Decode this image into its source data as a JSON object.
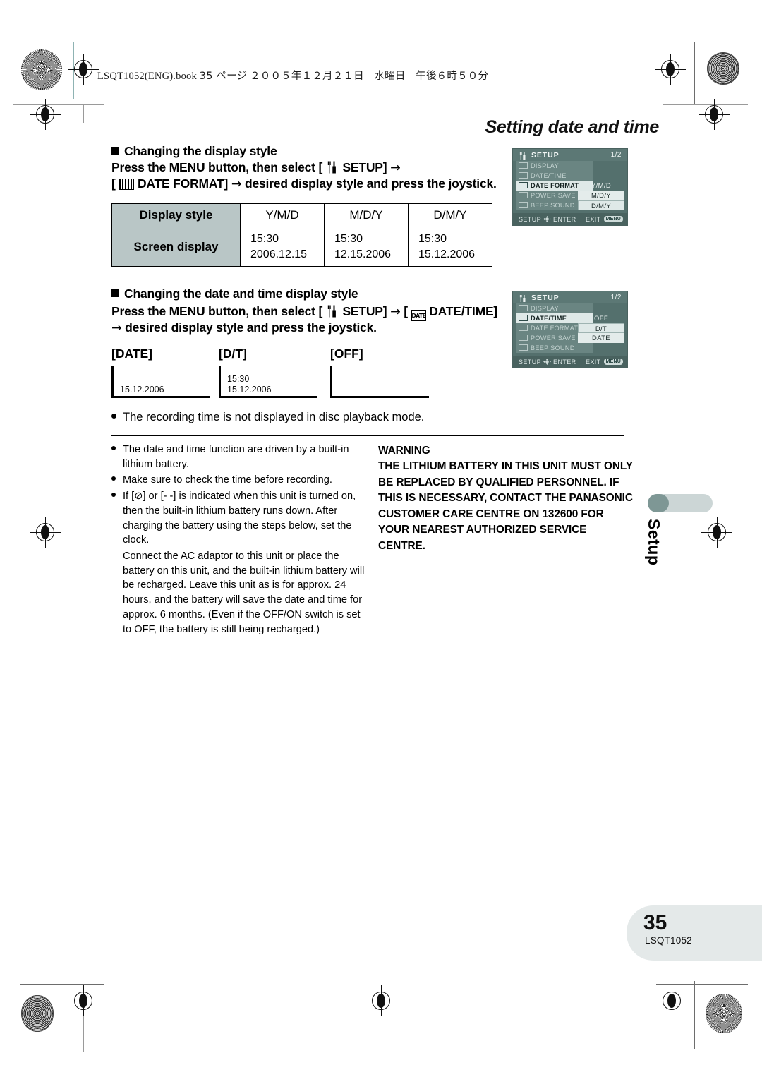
{
  "print": {
    "slug_code": "LSQT1052(ENG).book",
    "slug_page": "35 ページ",
    "slug_date": "２００５年１２月２１日　水曜日　午後６時５０分"
  },
  "running_title": "Setting date and time",
  "section1": {
    "heading": "Changing the display style",
    "line1_a": "Press the MENU button, then select [",
    "line1_setup": "SETUP]",
    "line1_arrow": "→",
    "line2_a": "[",
    "line2_b": "DATE FORMAT]",
    "line2_arrow": "→",
    "line2_c": "desired display style and press the joystick."
  },
  "table": {
    "row_label_1": "Display style",
    "row_label_2": "Screen display",
    "columns": [
      "Y/M/D",
      "M/D/Y",
      "D/M/Y"
    ],
    "values": [
      {
        "time": "15:30",
        "date": "2006.12.15"
      },
      {
        "time": "15:30",
        "date": "12.15.2006"
      },
      {
        "time": "15:30",
        "date": "15.12.2006"
      }
    ]
  },
  "section2": {
    "heading": "Changing the date and time display style",
    "line1_a": "Press the MENU button, then select [",
    "line1_setup": "SETUP]",
    "line1_arrow1": "→",
    "line1_b": "[",
    "line1_c": "DATE/TIME]",
    "line2_arrow": "→",
    "line2": "desired display style and press the joystick."
  },
  "samples": [
    {
      "label": "[DATE]",
      "time": "",
      "date": "15.12.2006"
    },
    {
      "label": "[D/T]",
      "time": "15:30",
      "date": "15.12.2006"
    },
    {
      "label": "[OFF]",
      "time": "",
      "date": ""
    }
  ],
  "note_top": "The recording time is not displayed in disc playback mode.",
  "notes": [
    "The date and time function are driven by a built-in lithium battery.",
    "Make sure to check the time before recording.",
    "If [⊘] or [- -] is indicated when this unit is turned on, then the built-in lithium battery runs down. After charging the battery using the steps below, set the clock."
  ],
  "notes_tail": "Connect the AC adaptor to this unit or place the battery on this unit, and the built-in lithium battery will be recharged. Leave this unit as is for approx. 24 hours, and the battery will save the date and time for approx. 6 months. (Even if the OFF/ON switch is set to OFF, the battery is still being recharged.)",
  "warning": {
    "title": "WARNING",
    "body": "THE LITHIUM BATTERY IN THIS UNIT MUST ONLY BE REPLACED BY QUALIFIED PERSONNEL. IF THIS IS NECESSARY, CONTACT THE PANASONIC CUSTOMER CARE CENTRE ON 132600 FOR YOUR NEAREST AUTHORIZED SERVICE CENTRE."
  },
  "lcd1": {
    "title": "SETUP",
    "page": "1/2",
    "rows": [
      {
        "label": "DISPLAY",
        "selected": false
      },
      {
        "label": "DATE/TIME",
        "selected": false
      },
      {
        "label": "DATE FORMAT",
        "selected": true
      },
      {
        "label": "POWER SAVE",
        "selected": false
      },
      {
        "label": "BEEP SOUND",
        "selected": false
      }
    ],
    "options": [
      {
        "label": "Y/M/D",
        "state": "plain"
      },
      {
        "label": "M/D/Y",
        "state": "lite"
      },
      {
        "label": "D/M/Y",
        "state": "box"
      }
    ],
    "foot_left": "SETUP",
    "foot_enter": "ENTER",
    "foot_exit": "EXIT",
    "foot_menu": "MENU"
  },
  "lcd2": {
    "title": "SETUP",
    "page": "1/2",
    "rows": [
      {
        "label": "DISPLAY",
        "selected": false
      },
      {
        "label": "DATE/TIME",
        "selected": true
      },
      {
        "label": "DATE FORMAT",
        "selected": false
      },
      {
        "label": "POWER SAVE",
        "selected": false
      },
      {
        "label": "BEEP SOUND",
        "selected": false
      }
    ],
    "options": [
      {
        "label": "OFF",
        "state": "plain"
      },
      {
        "label": "D/T",
        "state": "box"
      },
      {
        "label": "DATE",
        "state": "lite"
      }
    ],
    "foot_left": "SETUP",
    "foot_enter": "ENTER",
    "foot_exit": "EXIT",
    "foot_menu": "MENU"
  },
  "sidetab": "Setup",
  "footer": {
    "page_number": "35",
    "doc_code": "LSQT1052"
  }
}
